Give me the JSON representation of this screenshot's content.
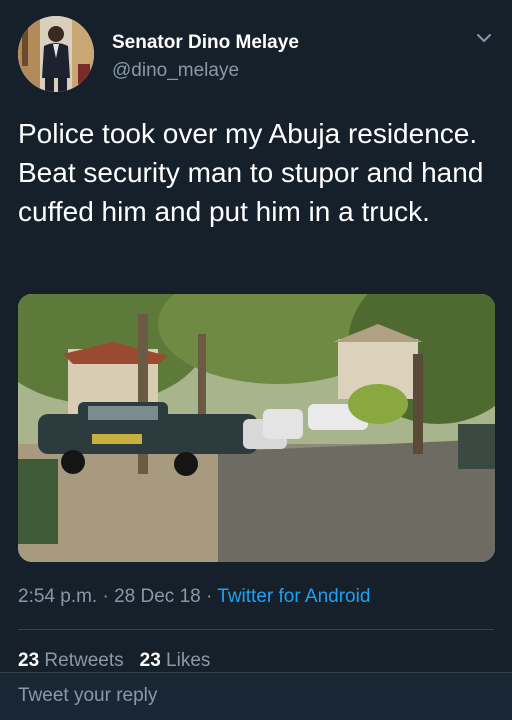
{
  "tweet": {
    "author_name": "Senator Dino Melaye",
    "author_handle": "@dino_melaye",
    "text": "Police took over my Abuja residence. Beat security man to stupor and hand cuffed him and put him in a truck.",
    "time": "2:54 p.m.",
    "separator": "·",
    "date": "28 Dec 18",
    "source": "Twitter for Android",
    "retweets_count": "23",
    "retweets_label": "Retweets",
    "likes_count": "23",
    "likes_label": "Likes"
  },
  "reply": {
    "placeholder": "Tweet your reply"
  },
  "icons": {
    "menu": "chevron-down-icon"
  },
  "colors": {
    "background": "#15202b",
    "text_primary": "#ffffff",
    "text_secondary": "#8899a6",
    "link": "#1da1f2",
    "divider": "#38444d"
  }
}
